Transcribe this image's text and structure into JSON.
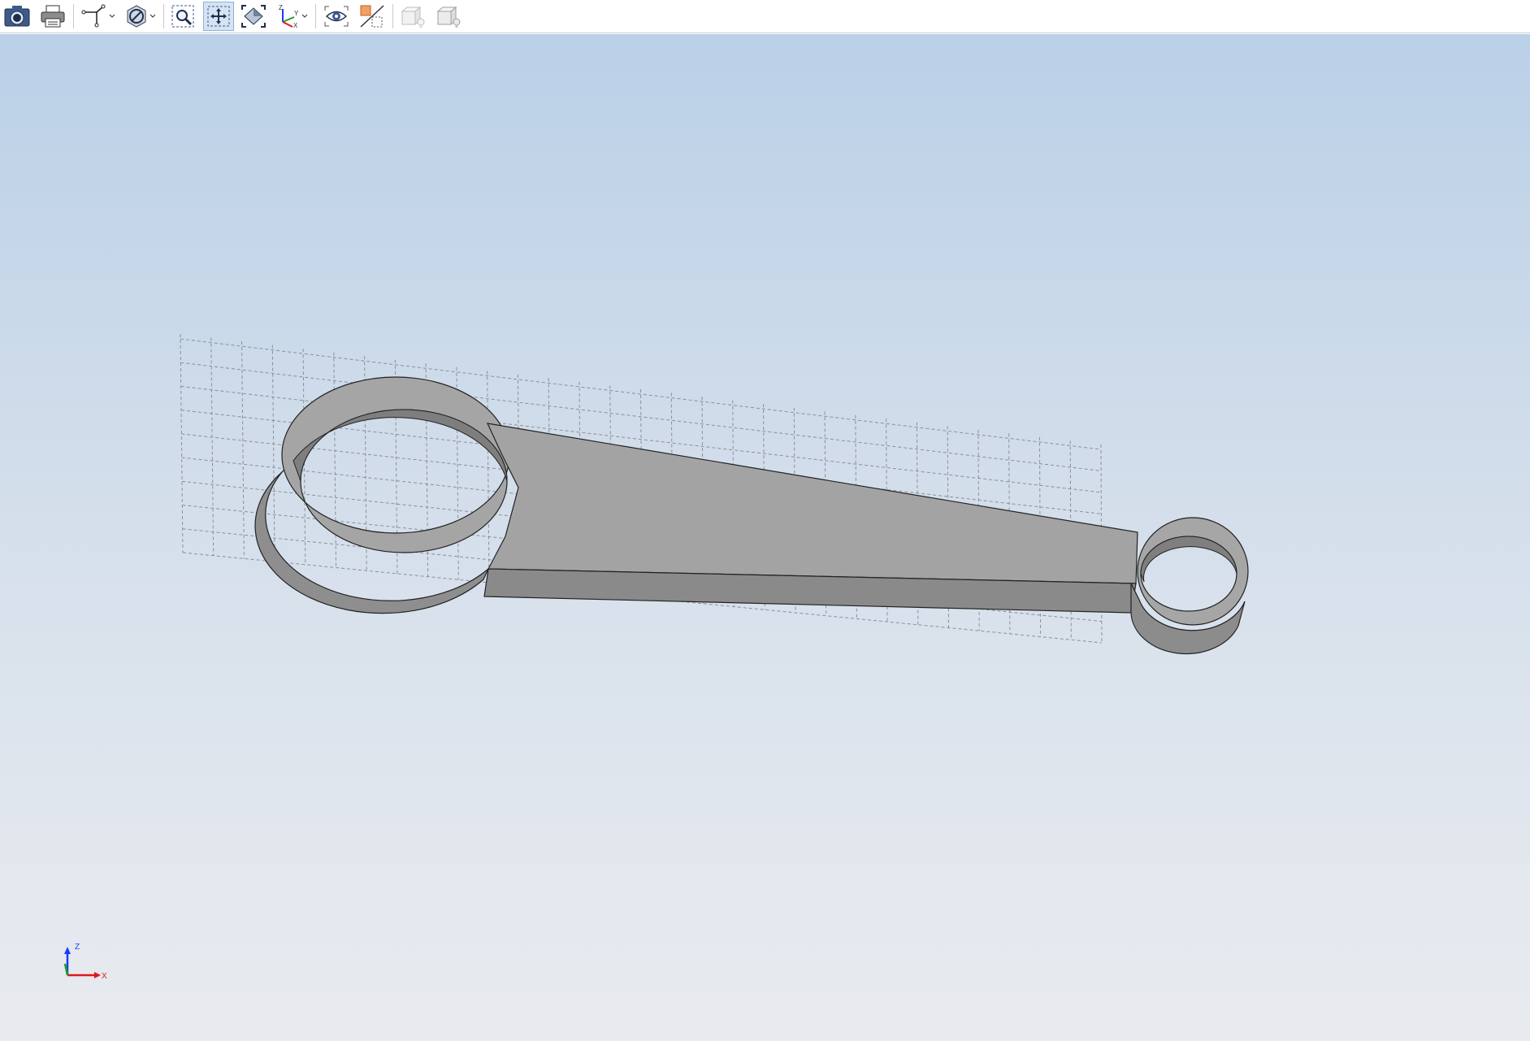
{
  "toolbar": {
    "buttons": [
      {
        "name": "screenshot-button",
        "icon": "camera-icon"
      },
      {
        "name": "print-button",
        "icon": "printer-icon"
      },
      {
        "name": "sketch-tools-button",
        "icon": "sketch-icon",
        "dropdown": true
      },
      {
        "name": "display-mode-button",
        "icon": "slash-circle-icon",
        "dropdown": true
      },
      {
        "name": "zoom-window-button",
        "icon": "zoom-window-icon"
      },
      {
        "name": "pan-button",
        "icon": "pan-icon",
        "active": true
      },
      {
        "name": "zoom-fit-button",
        "icon": "zoom-fit-icon"
      },
      {
        "name": "view-orientation-button",
        "icon": "axes-icon",
        "dropdown": true
      },
      {
        "name": "visibility-button",
        "icon": "eye-icon"
      },
      {
        "name": "section-view-button",
        "icon": "section-icon"
      },
      {
        "name": "lighting-off-button",
        "icon": "light-box-icon",
        "disabled": true
      },
      {
        "name": "lighting-on-button",
        "icon": "light-box-icon",
        "disabled": true
      }
    ]
  },
  "viewport": {
    "background_top": "#bad0e7",
    "background_bottom": "#e8eaee",
    "model": {
      "type": "connecting-rod",
      "color": "#a4a4a4",
      "edge_color": "#222222"
    },
    "grid": {
      "visible": true,
      "style": "dashed"
    },
    "triad": {
      "z_label": "Z",
      "x_label": "X",
      "z_color": "#1a3cff",
      "x_color": "#e01818",
      "y_color": "#1aa11a"
    }
  }
}
